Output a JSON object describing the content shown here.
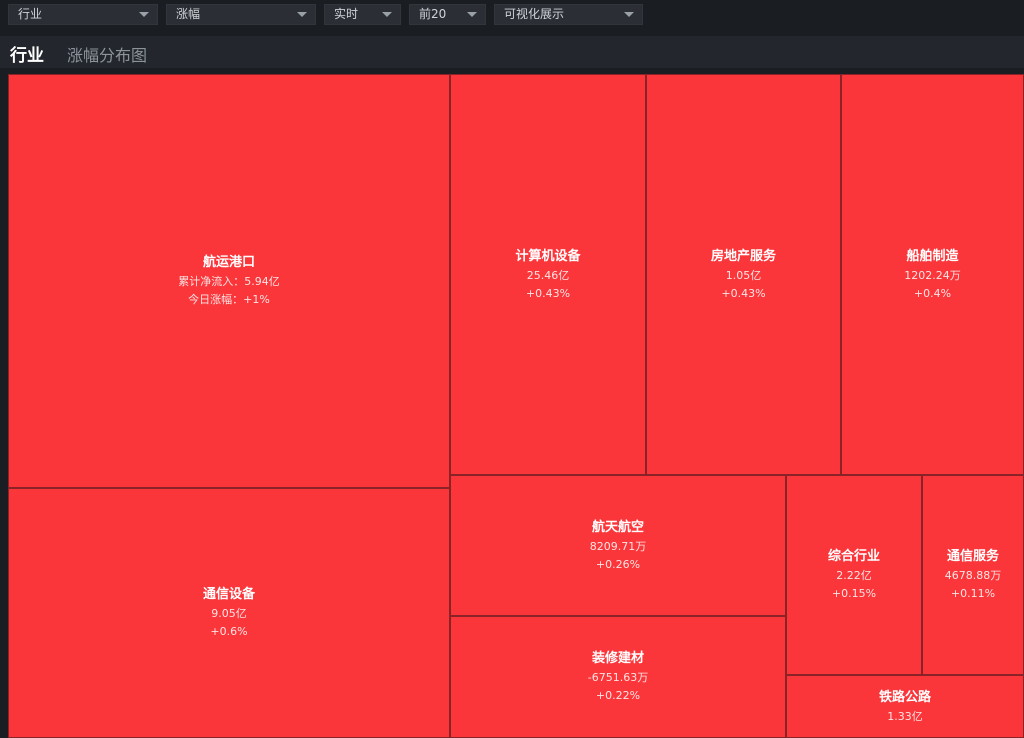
{
  "toolbar": {
    "dropdowns": [
      {
        "label": "行业"
      },
      {
        "label": "涨幅"
      },
      {
        "label": "实时"
      },
      {
        "label": "前20"
      },
      {
        "label": "可视化展示"
      }
    ]
  },
  "header": {
    "title": "行业",
    "subtitle": "涨幅分布图"
  },
  "colors": {
    "cell_up": "#fb363b",
    "background": "#1a1d22"
  },
  "treemap": {
    "cells": [
      {
        "name": "航运港口",
        "flow": "累计净流入：5.94亿",
        "change": "今日涨幅：+1%"
      },
      {
        "name": "通信设备",
        "flow": "9.05亿",
        "change": "+0.6%"
      },
      {
        "name": "计算机设备",
        "flow": "25.46亿",
        "change": "+0.43%"
      },
      {
        "name": "房地产服务",
        "flow": "1.05亿",
        "change": "+0.43%"
      },
      {
        "name": "船舶制造",
        "flow": "1202.24万",
        "change": "+0.4%"
      },
      {
        "name": "航天航空",
        "flow": "8209.71万",
        "change": "+0.26%"
      },
      {
        "name": "装修建材",
        "flow": "-6751.63万",
        "change": "+0.22%"
      },
      {
        "name": "综合行业",
        "flow": "2.22亿",
        "change": "+0.15%"
      },
      {
        "name": "通信服务",
        "flow": "4678.88万",
        "change": "+0.11%"
      },
      {
        "name": "铁路公路",
        "flow": "1.33亿",
        "change": ""
      }
    ]
  }
}
